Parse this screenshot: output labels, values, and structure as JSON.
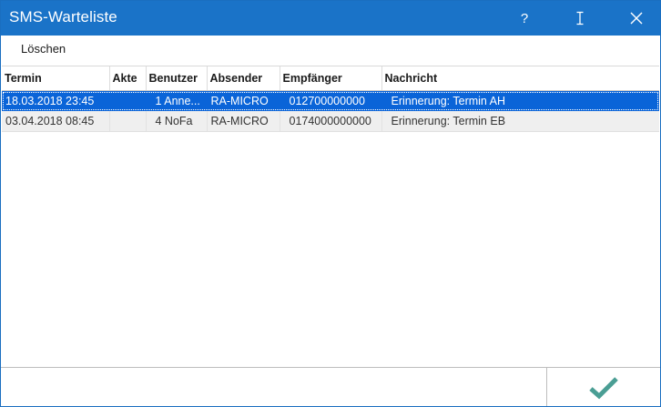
{
  "window": {
    "title": "SMS-Warteliste"
  },
  "titlebar": {
    "help_label": "?"
  },
  "menu": {
    "items": [
      {
        "label": "Löschen"
      }
    ]
  },
  "grid": {
    "columns": [
      "Termin",
      "Akte",
      "Benutzer",
      "Absender",
      "Empfänger",
      "Nachricht"
    ],
    "rows": [
      {
        "termin": "18.03.2018 23:45",
        "akte": "",
        "benutzer": "1 Anne...",
        "absender": "RA-MICRO",
        "empfaenger": "012700000000",
        "nachricht": "Erinnerung: Termin AH",
        "selected": true
      },
      {
        "termin": "03.04.2018 08:45",
        "akte": "",
        "benutzer": "4 NoFa",
        "absender": "RA-MICRO",
        "empfaenger": "0174000000000",
        "nachricht": "Erinnerung: Termin EB",
        "selected": false
      }
    ]
  },
  "status": {
    "text": ""
  },
  "colors": {
    "titlebar": "#1a73c8",
    "selection": "#0a64d8",
    "ok_check": "#4a9e94"
  },
  "icons": {
    "help": "question-mark-icon",
    "resize": "text-cursor-icon",
    "close": "close-icon",
    "ok": "checkmark-icon"
  }
}
